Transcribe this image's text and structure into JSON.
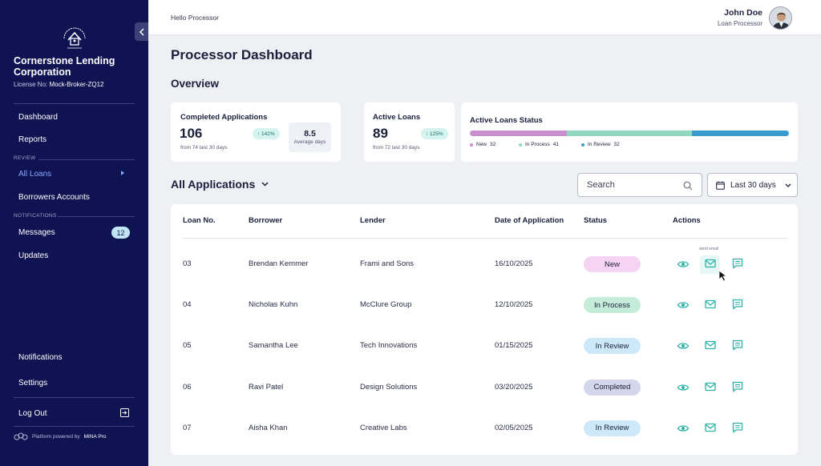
{
  "sidebar": {
    "company": "Cornerstone Lending Corporation",
    "license_label": "License No:",
    "license_value": "Mock-Broker-ZQ12",
    "nav": {
      "dashboard": "Dashboard",
      "reports": "Reports",
      "review_section": "REVIEW",
      "all_loans": "All Loans",
      "borrowers": "Borrowers Accounts",
      "notifications_section": "NOTIFICATIONS",
      "messages": "Messages",
      "messages_count": "12",
      "updates": "Updates",
      "notifications": "Notifications",
      "settings": "Settings",
      "logout": "Log Out"
    },
    "powered_prefix": "Platform powered by",
    "powered_brand": "MINA Pro"
  },
  "header": {
    "greeting": "Hello Processor",
    "user_name": "John Doe",
    "user_role": "Loan Processor"
  },
  "page": {
    "title": "Processor Dashboard",
    "overview": "Overview"
  },
  "cards": {
    "completed": {
      "title": "Completed Applications",
      "value": "106",
      "change": "↑ 142%",
      "sub": "from 74 last 30 days",
      "avg_value": "8.5",
      "avg_label": "Average days"
    },
    "active": {
      "title": "Active Loans",
      "value": "89",
      "change": "↑ 125%",
      "sub": "from 72 last 30 days"
    },
    "status": {
      "title": "Active Loans Status",
      "segments": [
        {
          "label": "New",
          "value": 32,
          "color": "#c98fcf"
        },
        {
          "label": "In Process",
          "value": 41,
          "color": "#8fd9c3"
        },
        {
          "label": "In Review",
          "value": 32,
          "color": "#3a9bcf"
        }
      ]
    }
  },
  "applications": {
    "title": "All Applications",
    "search_placeholder": "Search",
    "date_filter": "Last 30 days",
    "columns": [
      "Loan No.",
      "Borrower",
      "Lender",
      "Date of Application",
      "Status",
      "Actions"
    ],
    "tooltip": "send email",
    "rows": [
      {
        "loan": "03",
        "borrower": "Brendan Kemmer",
        "lender": "Frami and Sons",
        "date": "16/10/2025",
        "status": "New"
      },
      {
        "loan": "04",
        "borrower": "Nicholas Kuhn",
        "lender": "McClure Group",
        "date": "12/10/2025",
        "status": "In Process"
      },
      {
        "loan": "05",
        "borrower": "Samantha Lee",
        "lender": "Tech Innovations",
        "date": "01/15/2025",
        "status": "In Review"
      },
      {
        "loan": "06",
        "borrower": "Ravi Patel",
        "lender": "Design Solutions",
        "date": "03/20/2025",
        "status": "Completed"
      },
      {
        "loan": "07",
        "borrower": "Aisha Khan",
        "lender": "Creative Labs",
        "date": "02/05/2025",
        "status": "In Review"
      }
    ]
  },
  "colors": {
    "sidebar_bg": "#0f1352",
    "accent_teal": "#2bb3a8",
    "status_new": "#f5d4f3",
    "status_in_process": "#c5ecd9",
    "status_in_review": "#cde8f8",
    "status_completed": "#d4d6ea"
  }
}
